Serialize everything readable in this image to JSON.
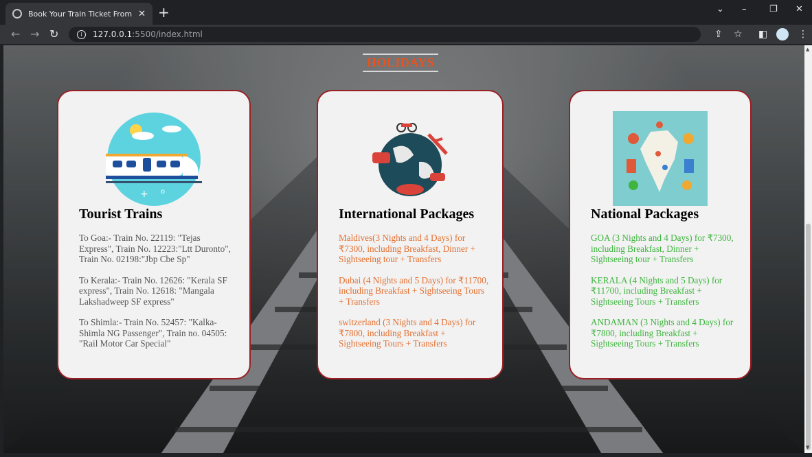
{
  "browser": {
    "tab_title": "Book Your Train Ticket From Your",
    "tab_close": "✕",
    "new_tab": "+",
    "url_host": "127.0.0.1",
    "url_rest": ":5500/index.html",
    "win_down": "⌄",
    "win_min": "–",
    "win_restore": "❐",
    "win_close": "✕"
  },
  "page": {
    "heading": "HOLIDAYS"
  },
  "cards": [
    {
      "title": "Tourist Trains",
      "image_icon": "train-illustration-icon",
      "paragraphs": [
        "To Goa:- Train No. 22119: \"Tejas Express\", Train No. 12223:\"Ltt Duronto\", Train No. 02198:\"Jbp Cbe Sp\"",
        "To Kerala:- Train No. 12626: \"Kerala SF express\", Train No. 12618: \"Mangala Lakshadweep SF express\"",
        "To Shimla:- Train No. 52457: \"Kalka-Shimla NG Passenger\", Train no. 04505: \"Rail Motor Car Special\""
      ]
    },
    {
      "title": "International Packages",
      "image_icon": "globe-travel-icon",
      "paragraphs": [
        "Maldives(3 Nights and 4 Days) for ₹7300, including Breakfast, Dinner + Sightseeing tour + Transfers",
        "Dubai (4 Nights and 5 Days) for ₹11700, including Breakfast + Sightseeing Tours + Transfers",
        "switzerland (3 Nights and 4 Days) for ₹7800, including Breakfast + Sightseeing Tours + Transfers"
      ]
    },
    {
      "title": "National Packages",
      "image_icon": "india-map-icon",
      "paragraphs": [
        "GOA (3 Nights and 4 Days) for ₹7300, including Breakfast, Dinner + Sightseeing tour + Transfers",
        "KERALA (4 Nights and 5 Days) for ₹11700, including Breakfast + Sightseeing Tours + Transfers",
        "ANDAMAN (3 Nights and 4 Days) for ₹7800, including Breakfast + Sightseeing Tours + Transfers"
      ]
    }
  ],
  "colors": {
    "heading": "#e8531f",
    "card_border": "#9a1f24",
    "card1_text": "#555555",
    "card2_text": "#e47031",
    "card3_text": "#3fb53f"
  }
}
